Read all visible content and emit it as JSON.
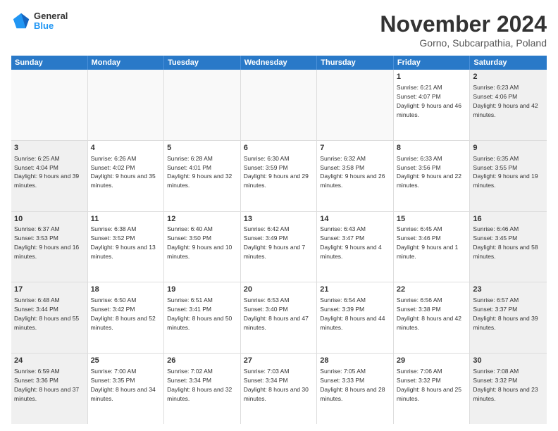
{
  "logo": {
    "line1": "General",
    "line2": "Blue"
  },
  "title": "November 2024",
  "subtitle": "Gorno, Subcarpathia, Poland",
  "days": [
    "Sunday",
    "Monday",
    "Tuesday",
    "Wednesday",
    "Thursday",
    "Friday",
    "Saturday"
  ],
  "weeks": [
    [
      {
        "day": "",
        "text": ""
      },
      {
        "day": "",
        "text": ""
      },
      {
        "day": "",
        "text": ""
      },
      {
        "day": "",
        "text": ""
      },
      {
        "day": "",
        "text": ""
      },
      {
        "day": "1",
        "text": "Sunrise: 6:21 AM\nSunset: 4:07 PM\nDaylight: 9 hours and 46 minutes."
      },
      {
        "day": "2",
        "text": "Sunrise: 6:23 AM\nSunset: 4:06 PM\nDaylight: 9 hours and 42 minutes."
      }
    ],
    [
      {
        "day": "3",
        "text": "Sunrise: 6:25 AM\nSunset: 4:04 PM\nDaylight: 9 hours and 39 minutes."
      },
      {
        "day": "4",
        "text": "Sunrise: 6:26 AM\nSunset: 4:02 PM\nDaylight: 9 hours and 35 minutes."
      },
      {
        "day": "5",
        "text": "Sunrise: 6:28 AM\nSunset: 4:01 PM\nDaylight: 9 hours and 32 minutes."
      },
      {
        "day": "6",
        "text": "Sunrise: 6:30 AM\nSunset: 3:59 PM\nDaylight: 9 hours and 29 minutes."
      },
      {
        "day": "7",
        "text": "Sunrise: 6:32 AM\nSunset: 3:58 PM\nDaylight: 9 hours and 26 minutes."
      },
      {
        "day": "8",
        "text": "Sunrise: 6:33 AM\nSunset: 3:56 PM\nDaylight: 9 hours and 22 minutes."
      },
      {
        "day": "9",
        "text": "Sunrise: 6:35 AM\nSunset: 3:55 PM\nDaylight: 9 hours and 19 minutes."
      }
    ],
    [
      {
        "day": "10",
        "text": "Sunrise: 6:37 AM\nSunset: 3:53 PM\nDaylight: 9 hours and 16 minutes."
      },
      {
        "day": "11",
        "text": "Sunrise: 6:38 AM\nSunset: 3:52 PM\nDaylight: 9 hours and 13 minutes."
      },
      {
        "day": "12",
        "text": "Sunrise: 6:40 AM\nSunset: 3:50 PM\nDaylight: 9 hours and 10 minutes."
      },
      {
        "day": "13",
        "text": "Sunrise: 6:42 AM\nSunset: 3:49 PM\nDaylight: 9 hours and 7 minutes."
      },
      {
        "day": "14",
        "text": "Sunrise: 6:43 AM\nSunset: 3:47 PM\nDaylight: 9 hours and 4 minutes."
      },
      {
        "day": "15",
        "text": "Sunrise: 6:45 AM\nSunset: 3:46 PM\nDaylight: 9 hours and 1 minute."
      },
      {
        "day": "16",
        "text": "Sunrise: 6:46 AM\nSunset: 3:45 PM\nDaylight: 8 hours and 58 minutes."
      }
    ],
    [
      {
        "day": "17",
        "text": "Sunrise: 6:48 AM\nSunset: 3:44 PM\nDaylight: 8 hours and 55 minutes."
      },
      {
        "day": "18",
        "text": "Sunrise: 6:50 AM\nSunset: 3:42 PM\nDaylight: 8 hours and 52 minutes."
      },
      {
        "day": "19",
        "text": "Sunrise: 6:51 AM\nSunset: 3:41 PM\nDaylight: 8 hours and 50 minutes."
      },
      {
        "day": "20",
        "text": "Sunrise: 6:53 AM\nSunset: 3:40 PM\nDaylight: 8 hours and 47 minutes."
      },
      {
        "day": "21",
        "text": "Sunrise: 6:54 AM\nSunset: 3:39 PM\nDaylight: 8 hours and 44 minutes."
      },
      {
        "day": "22",
        "text": "Sunrise: 6:56 AM\nSunset: 3:38 PM\nDaylight: 8 hours and 42 minutes."
      },
      {
        "day": "23",
        "text": "Sunrise: 6:57 AM\nSunset: 3:37 PM\nDaylight: 8 hours and 39 minutes."
      }
    ],
    [
      {
        "day": "24",
        "text": "Sunrise: 6:59 AM\nSunset: 3:36 PM\nDaylight: 8 hours and 37 minutes."
      },
      {
        "day": "25",
        "text": "Sunrise: 7:00 AM\nSunset: 3:35 PM\nDaylight: 8 hours and 34 minutes."
      },
      {
        "day": "26",
        "text": "Sunrise: 7:02 AM\nSunset: 3:34 PM\nDaylight: 8 hours and 32 minutes."
      },
      {
        "day": "27",
        "text": "Sunrise: 7:03 AM\nSunset: 3:34 PM\nDaylight: 8 hours and 30 minutes."
      },
      {
        "day": "28",
        "text": "Sunrise: 7:05 AM\nSunset: 3:33 PM\nDaylight: 8 hours and 28 minutes."
      },
      {
        "day": "29",
        "text": "Sunrise: 7:06 AM\nSunset: 3:32 PM\nDaylight: 8 hours and 25 minutes."
      },
      {
        "day": "30",
        "text": "Sunrise: 7:08 AM\nSunset: 3:32 PM\nDaylight: 8 hours and 23 minutes."
      }
    ]
  ]
}
